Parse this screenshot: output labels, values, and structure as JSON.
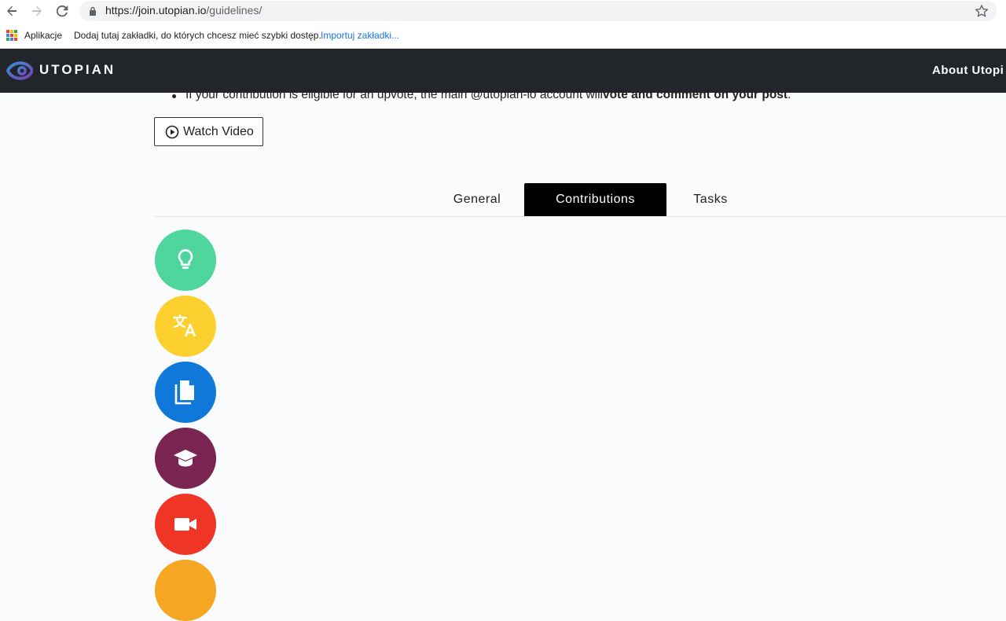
{
  "browser": {
    "url_host": "https://join.utopian.io",
    "url_path": "/guidelines/",
    "bookmarks": {
      "apps_label": "Aplikacje",
      "hint": "Dodaj tutaj zakładki, do których chcesz mieć szybki dostęp.",
      "import_label": "Importuj zakładki..."
    }
  },
  "header": {
    "logo_text": "UTOPIAN",
    "nav_about": "About Utopi"
  },
  "content": {
    "bullet_text": "If your contribution is eligible for an upvote, the main @utopian-io account will ",
    "bullet_bold": "vote and comment on your post",
    "bullet_end": ".",
    "watch_video": "Watch Video"
  },
  "tabs": [
    {
      "label": "General",
      "active": false
    },
    {
      "label": "Contributions",
      "active": true
    },
    {
      "label": "Tasks",
      "active": false
    }
  ],
  "categories": [
    {
      "icon": "lightbulb-icon",
      "color": "#4fd69c"
    },
    {
      "icon": "translate-icon",
      "color": "#fcd12f"
    },
    {
      "icon": "documents-icon",
      "color": "#0f78d9"
    },
    {
      "icon": "graduation-cap-icon",
      "color": "#7a2551"
    },
    {
      "icon": "video-camera-icon",
      "color": "#ef3526"
    },
    {
      "icon": "partial-icon",
      "color": "#f5a623"
    }
  ]
}
